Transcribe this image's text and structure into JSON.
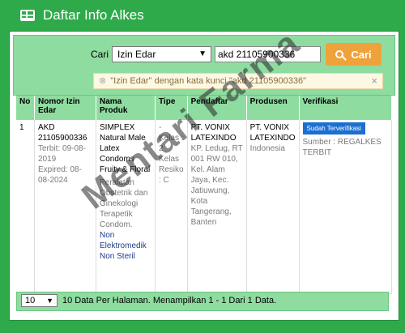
{
  "header": {
    "title": "Daftar Info Alkes",
    "icon": "table-icon"
  },
  "search": {
    "label": "Cari",
    "filter_selected": "Izin Edar",
    "query": "akd 21105900336",
    "button_label": "Cari",
    "alert_text": "\"Izin Edar\" dengan kata kunci \"akd 21105900336\"",
    "alert_close": "×"
  },
  "table": {
    "headers": [
      "No",
      "Nomor Izin Edar",
      "Nama Produk",
      "Tipe",
      "Pendaftar",
      "Produsen",
      "Verifikasi"
    ],
    "rows": [
      {
        "no": "1",
        "nomor": "AKD 21105900336",
        "terbit": "Terbit: 09-08-2019",
        "expired": "Expired: 08-08-2024",
        "produk_nama": "SIMPLEX Natural Male Latex Condoms Fruity & Floral",
        "produk_kategori": "Peralatan Obstetrik dan Ginekologi Terapetik Condom.",
        "produk_jenis": "Non Elektromedik Non Steril",
        "tipe": "- Kelas : 2 Kelas Resiko : C",
        "pendaftar_nama": "PT. VONIX LATEXINDO",
        "pendaftar_alamat": "KP. Ledug, RT 001 RW 010, Kel. Alam Jaya, Kec. Jatiuwung, Kota Tangerang, Banten",
        "produsen_nama": "PT. VONIX LATEXINDO",
        "produsen_negara": "Indonesia",
        "verifikasi_badge": "Sudah Terverifikasi",
        "verifikasi_sumber": "Sumber : REGALKES TERBIT"
      }
    ]
  },
  "footer": {
    "page_size": "10",
    "info": "10 Data Per Halaman. Menampilkan 1 - 1 Dari 1 Data."
  },
  "watermark": "Mentari Farma",
  "colors": {
    "header_bg": "#2eaa4a",
    "accent_green": "#8fdca0",
    "button_orange": "#f0a23a",
    "badge_blue": "#1b6fd1"
  }
}
